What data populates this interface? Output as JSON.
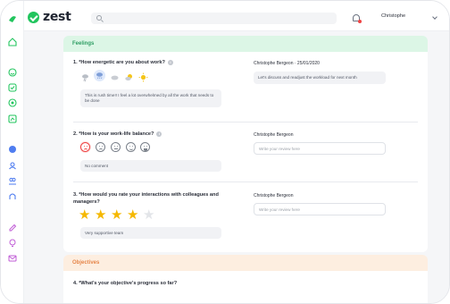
{
  "app": {
    "logo_text": "zest"
  },
  "header": {
    "username": "Christophe"
  },
  "rail_icons": [
    "home-icon",
    "smile-icon",
    "check-icon",
    "target-icon",
    "chart-icon",
    "circle-icon",
    "people-icon",
    "group-icon",
    "org-icon",
    "edit-icon",
    "bulb-icon",
    "mail-icon"
  ],
  "feelings": {
    "title": "Feelings",
    "q1": {
      "question": "1. *How energetic are you about work?",
      "info": "i",
      "weather_icons": [
        "storm-icon",
        "rain-icon",
        "cloud-icon",
        "partly-sunny-icon",
        "sun-icon"
      ],
      "selected_index": 1,
      "answer": "This is rush time!! I feel a lot overwhelmed by all the work that needs to be done",
      "reviewer": "Christophe Bergeon · 25/01/2020",
      "review": "Let's discuss and readjust the workload for next month"
    },
    "q2": {
      "question": "2. *How is your work-life balance?",
      "info": "i",
      "smileys": [
        "very-sad",
        "sad",
        "neutral",
        "happy",
        "very-happy"
      ],
      "selected_index": 0,
      "answer": "No comment",
      "reviewer": "Christophe Bergeon",
      "review_placeholder": "Write your review here"
    },
    "q3": {
      "question_line1": "3. *How would you rate your interactions with colleagues and",
      "question_line2": "managers?",
      "rating": 4,
      "max_rating": 5,
      "answer": "Very supportive team",
      "reviewer": "Christophe Bergeon",
      "review_placeholder": "Write your review here"
    }
  },
  "objectives": {
    "title": "Objectives",
    "q4": {
      "question": "4. *What's your objective's progress so far?"
    }
  },
  "colors": {
    "accent_green": "#22c55e",
    "feelings_bg": "#dcf6e6",
    "objectives_bg": "#fdeee0",
    "star": "#f5b800",
    "selected_smiley": "#ef4444"
  }
}
